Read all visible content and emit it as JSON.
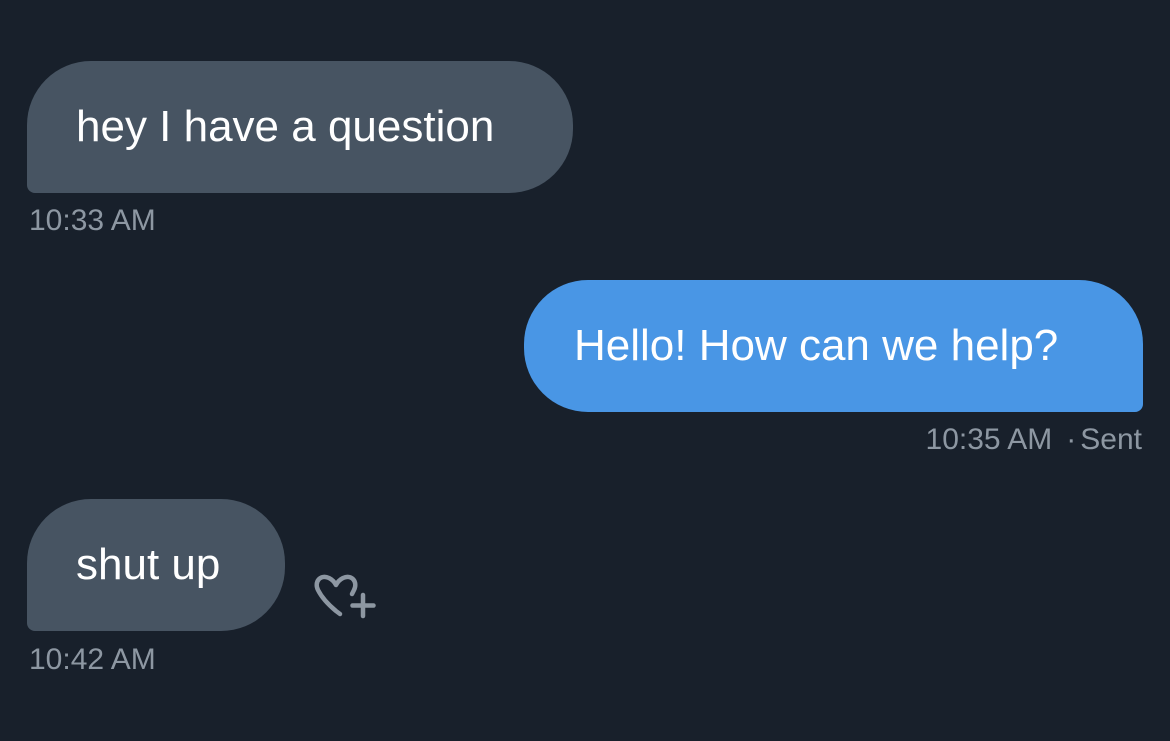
{
  "messages": [
    {
      "text": "hey I have a question",
      "time": "10:33 AM",
      "direction": "received"
    },
    {
      "text": "Hello! How can we help?",
      "time": "10:35 AM",
      "status": "Sent",
      "separator": "·",
      "direction": "sent"
    },
    {
      "text": "shut up",
      "time": "10:42 AM",
      "direction": "received"
    }
  ],
  "react_button": {
    "icon": "heart-plus-icon"
  },
  "colors": {
    "background": "#18202b",
    "received_bubble": "#475462",
    "sent_bubble": "#4996e5",
    "meta_text": "#8d97a2",
    "bubble_text": "#ffffff"
  }
}
